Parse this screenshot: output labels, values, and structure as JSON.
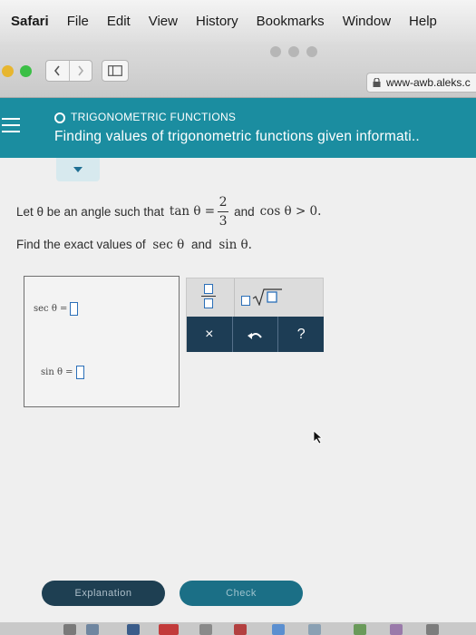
{
  "menubar": {
    "app": "Safari",
    "items": [
      "File",
      "Edit",
      "View",
      "History",
      "Bookmarks",
      "Window",
      "Help"
    ]
  },
  "toolbar": {
    "back_icon": "chevron-left-icon",
    "forward_icon": "chevron-right-icon",
    "url": "www-awb.aleks.c"
  },
  "header": {
    "topic": "TRIGONOMETRIC FUNCTIONS",
    "title": "Finding values of trigonometric functions given informati..",
    "accent_color": "#1b8da0"
  },
  "problem": {
    "line1_prefix": "Let θ be an angle such that",
    "tan_expr": "tan θ =",
    "numerator": "2",
    "denominator": "3",
    "line1_and": "and",
    "cos_expr": "cos θ > 0.",
    "line2_prefix": "Find the exact values of",
    "sec_expr": "sec θ",
    "line2_and": "and",
    "sin_expr": "sin θ."
  },
  "answers": {
    "sec_label": "sec θ  =",
    "sin_label": "sin θ  =",
    "sec_value": "",
    "sin_value": ""
  },
  "palette": {
    "clear_label": "×",
    "undo_icon": "undo-icon",
    "help_label": "?"
  },
  "buttons": {
    "explanation": "Explanation",
    "check": "Check"
  }
}
